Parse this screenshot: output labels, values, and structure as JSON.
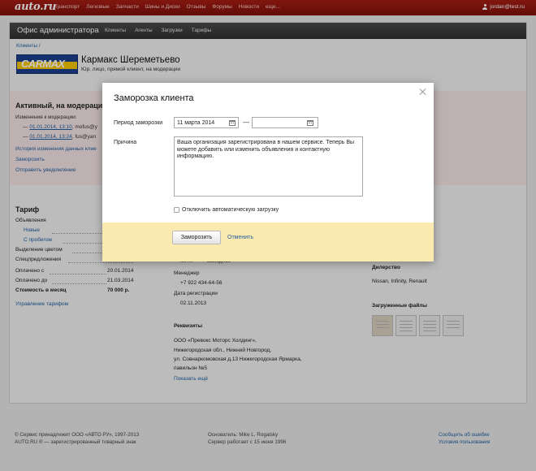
{
  "topbar": {
    "logo": "auto.ru",
    "nav": [
      "Транспорт",
      "Легковые",
      "Запчасти",
      "Шины и Диски",
      "Отзывы",
      "Форумы",
      "Новости",
      "еще..."
    ],
    "user": "jordan@test.ru"
  },
  "adminbar": {
    "title": "Офис администратора",
    "nav": [
      "Клиенты",
      "Агенты",
      "Загрузки",
      "Тарифы"
    ]
  },
  "breadcrumb": {
    "item": "Клиенты",
    "sep": "/"
  },
  "client": {
    "logo_text": "CARMAX",
    "name": "Кармакс Шереметьево",
    "subtitle": "Юр. лицо, прямой клиент, на модерации"
  },
  "moderation": {
    "title": "Активный, на модерации",
    "changes_label": "Изменения к модерации:",
    "entries": [
      {
        "prefix": "—",
        "date": "01.01.2014, 13:10",
        "who": "mofus@y"
      },
      {
        "prefix": "—",
        "date": "01.01.2014, 13:24",
        "who": "fus@yan"
      }
    ],
    "links": [
      "История изменения данных клие",
      "Заморозить",
      "Отправить уведомление"
    ]
  },
  "tariff": {
    "title": "Тариф",
    "rows": [
      {
        "label": "Объявления",
        "value": "",
        "type": "plain"
      },
      {
        "label": "Новые",
        "value": "",
        "type": "link"
      },
      {
        "label": "С пробегом",
        "value": "",
        "type": "link"
      },
      {
        "label": "Выделение цветом",
        "value": "",
        "type": "plain"
      },
      {
        "label": "Спецпредложения",
        "value": "",
        "type": "plain"
      },
      {
        "label": "Оплачено с",
        "value": "20.01.2014",
        "type": "plain"
      },
      {
        "label": "Оплачено до",
        "value": "21.03.2014",
        "type": "plain"
      },
      {
        "label": "Стоимость в месяц",
        "value": "70 000 р.",
        "type": "bold"
      }
    ],
    "manage_link": "Управление тарифом"
  },
  "info": {
    "hours_fragment": "пн-пт",
    "hours_value": "выходной",
    "manager_label": "Менеджер",
    "manager_phone": "+7 922 434-64-56",
    "reg_label": "Дата регистрации",
    "reg_date": "02.11.2013",
    "requisites_title": "Реквизиты",
    "req_lines": [
      "ООО «Превокс Моторс Холдинг»,",
      "Нижегородская обл., Нижний Новгород,",
      "ул. Совнаркомовская д.13 Нижегородская Ярмарка,",
      "павильон №5"
    ],
    "show_more": "Показать ещё"
  },
  "right": {
    "dealer_title": "Дилерство",
    "dealer_value": "Nissan, Infinity, Renault",
    "files_title": "Загруженные файлы"
  },
  "footer": {
    "copyright": "© Сервис принадлежит ООО «АВТО РУ», 1997-2013",
    "trademark": "AUTO.RU ® — зарегистрированный товарный знак",
    "founder": "Основатель: Mike L. Rogalsky",
    "since": "Сервер работает с 15 июня 1996",
    "report": "Сообщить об ошибке",
    "terms": "Условия пользования"
  },
  "modal": {
    "title": "Заморозка клиента",
    "period_label": "Период заморозки",
    "date_from": "11 марта 2014",
    "date_to": "",
    "dash": "—",
    "reason_label": "Причина",
    "reason_text": "Ваша организация зарегистрирована в нашем сервисе. Теперь Вы можете добавить или изменить объявления и контактную информацию.",
    "checkbox_label": "Отключить автоматическую загрузку",
    "submit_label": "Заморозить",
    "cancel_label": "Отменить"
  }
}
